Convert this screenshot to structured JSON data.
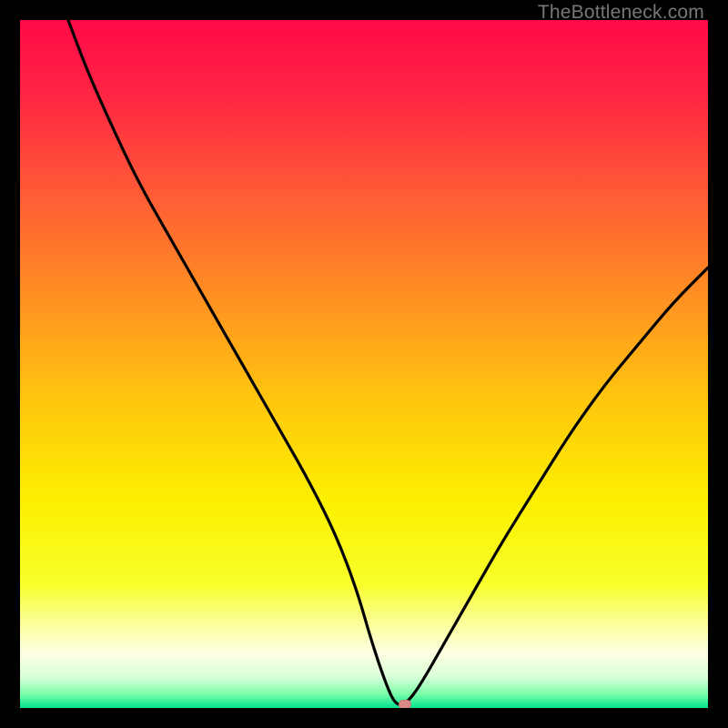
{
  "watermark": "TheBottleneck.com",
  "colors": {
    "frame": "#000000",
    "gradient_stops": [
      {
        "offset": 0.0,
        "color": "#ff0a47"
      },
      {
        "offset": 0.1,
        "color": "#ff2244"
      },
      {
        "offset": 0.25,
        "color": "#ff5a36"
      },
      {
        "offset": 0.4,
        "color": "#ff8f22"
      },
      {
        "offset": 0.55,
        "color": "#ffc50e"
      },
      {
        "offset": 0.7,
        "color": "#fcf000"
      },
      {
        "offset": 0.82,
        "color": "#f8ff2a"
      },
      {
        "offset": 0.88,
        "color": "#fbffa0"
      },
      {
        "offset": 0.92,
        "color": "#feffe2"
      },
      {
        "offset": 0.955,
        "color": "#d8ffd8"
      },
      {
        "offset": 0.98,
        "color": "#7affa8"
      },
      {
        "offset": 1.0,
        "color": "#00e18f"
      }
    ],
    "curve": "#000000",
    "marker_fill": "#d98b86",
    "marker_stroke": "#c47772"
  },
  "chart_data": {
    "type": "line",
    "title": "",
    "xlabel": "",
    "ylabel": "",
    "xlim": [
      0,
      100
    ],
    "ylim": [
      0,
      100
    ],
    "x": [
      7,
      10,
      15,
      18,
      22,
      26,
      30,
      34,
      38,
      42,
      46,
      49,
      51,
      53,
      54.5,
      56,
      58,
      62,
      66,
      70,
      75,
      80,
      85,
      90,
      95,
      100
    ],
    "values": [
      100,
      92,
      81,
      75,
      68,
      61,
      54,
      47,
      40,
      33,
      25,
      17,
      10,
      4,
      0.5,
      0.5,
      3,
      10,
      17,
      24,
      32,
      40,
      47,
      53,
      59,
      64
    ],
    "marker": {
      "x": 56,
      "y": 0.5
    },
    "annotations": [
      {
        "text": "TheBottleneck.com",
        "pos": "top-right"
      }
    ]
  }
}
